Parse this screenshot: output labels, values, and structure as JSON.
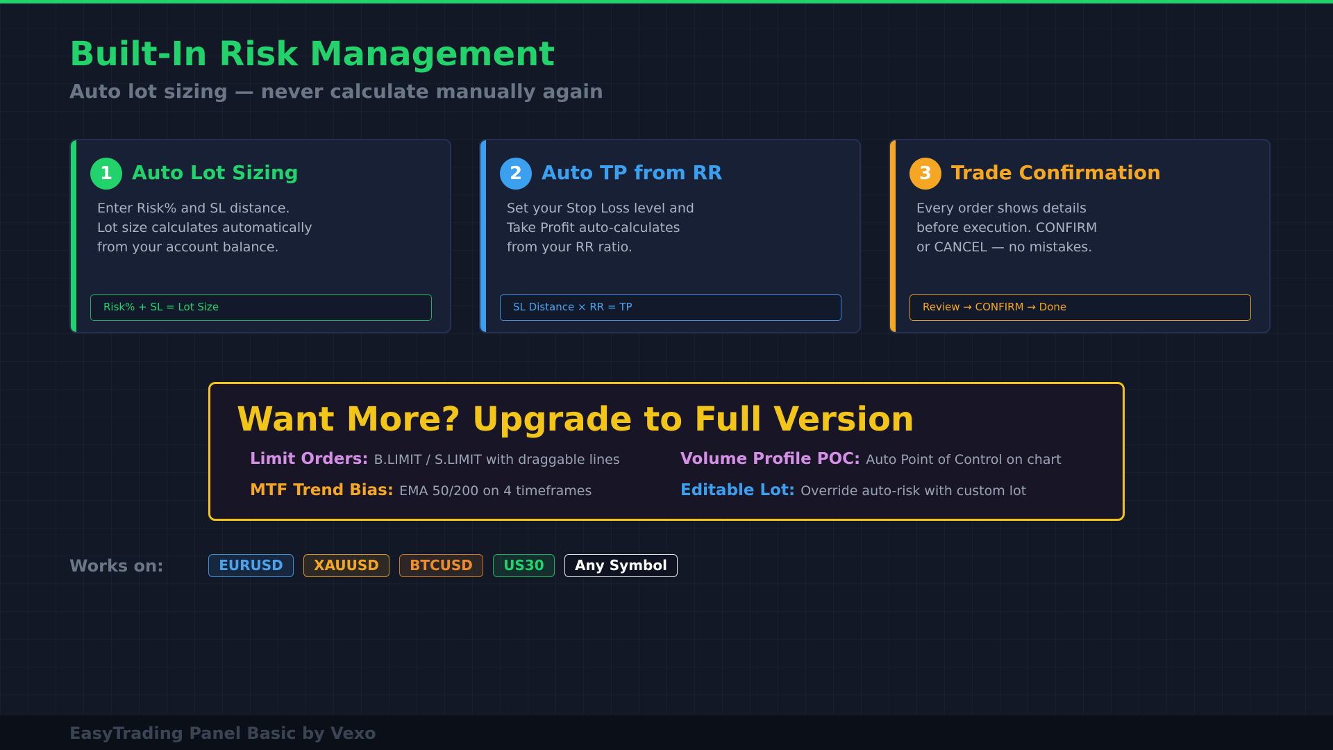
{
  "colors": {
    "accent_green": "#22d36b",
    "accent_blue": "#3ca0f0",
    "accent_orange": "#f5a623",
    "accent_yellow": "#f2c518",
    "accent_purple": "#d68fe6",
    "background": "#121826"
  },
  "header": {
    "title": "Built-In Risk Management",
    "subtitle": "Auto lot sizing — never calculate manually again"
  },
  "cards": [
    {
      "number": "1",
      "title": "Auto Lot Sizing",
      "lines": [
        "Enter Risk% and SL distance.",
        "Lot size calculates automatically",
        "from your account balance."
      ],
      "formula": "Risk% + SL = Lot Size"
    },
    {
      "number": "2",
      "title": "Auto TP from RR",
      "lines": [
        "Set your Stop Loss level and",
        "Take Profit auto-calculates",
        "from your RR ratio."
      ],
      "formula": "SL Distance × RR = TP"
    },
    {
      "number": "3",
      "title": "Trade Confirmation",
      "lines": [
        "Every order shows details",
        "before execution. CONFIRM",
        "or CANCEL — no mistakes."
      ],
      "formula": "Review → CONFIRM → Done"
    }
  ],
  "upgrade": {
    "title": "Want More? Upgrade to Full Version",
    "features": [
      {
        "name": "Limit Orders:",
        "desc": "B.LIMIT / S.LIMIT with draggable lines"
      },
      {
        "name": "Volume Profile POC:",
        "desc": "Auto Point of Control on chart"
      },
      {
        "name": "MTF Trend Bias:",
        "desc": "EMA 50/200 on 4 timeframes"
      },
      {
        "name": "Editable Lot:",
        "desc": "Override auto-risk with custom lot"
      }
    ]
  },
  "works_on": {
    "label": "Works on:",
    "symbols": [
      "EURUSD",
      "XAUUSD",
      "BTCUSD",
      "US30",
      "Any Symbol"
    ]
  },
  "footer": {
    "text": "EasyTrading Panel Basic by Vexo"
  }
}
